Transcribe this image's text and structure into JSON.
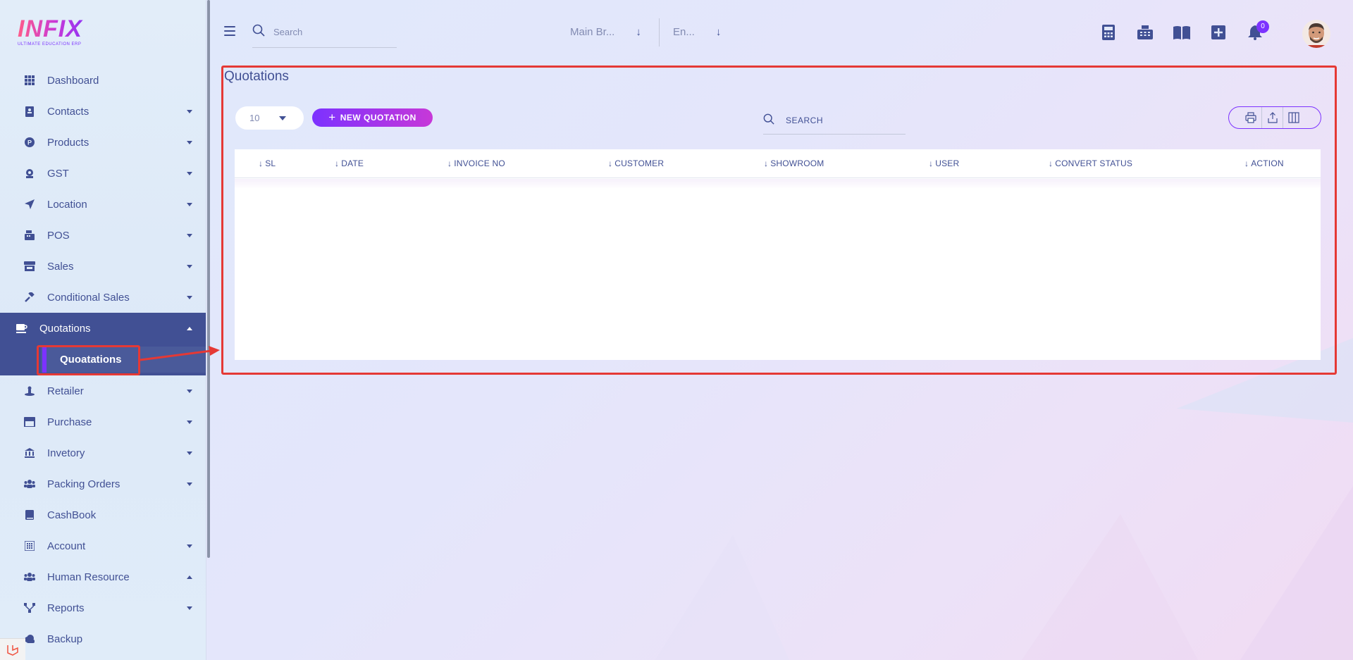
{
  "brand": {
    "logo_text": "INFIX",
    "logo_subtitle": "ULTIMATE EDUCATION ERP"
  },
  "sidebar": {
    "items": [
      {
        "label": "Dashboard",
        "icon": "grid-icon",
        "has_caret": false
      },
      {
        "label": "Contacts",
        "icon": "contacts-icon",
        "has_caret": true
      },
      {
        "label": "Products",
        "icon": "products-icon",
        "has_caret": true
      },
      {
        "label": "GST",
        "icon": "gst-icon",
        "has_caret": true
      },
      {
        "label": "Location",
        "icon": "location-arrow-icon",
        "has_caret": true
      },
      {
        "label": "POS",
        "icon": "cash-register-icon",
        "has_caret": true
      },
      {
        "label": "Sales",
        "icon": "store-icon",
        "has_caret": true
      },
      {
        "label": "Conditional Sales",
        "icon": "gavel-icon",
        "has_caret": true
      },
      {
        "label": "Quotations",
        "icon": "coffee-cup-icon",
        "has_caret": true,
        "expanded": true
      },
      {
        "label": "Retailer",
        "icon": "retailer-icon",
        "has_caret": true
      },
      {
        "label": "Purchase",
        "icon": "purchase-store-icon",
        "has_caret": true
      },
      {
        "label": "Invetory",
        "icon": "bank-icon",
        "has_caret": true
      },
      {
        "label": "Packing Orders",
        "icon": "users-icon",
        "has_caret": true
      },
      {
        "label": "CashBook",
        "icon": "book-icon",
        "has_caret": false
      },
      {
        "label": "Account",
        "icon": "calculator-icon",
        "has_caret": true
      },
      {
        "label": "Human Resource",
        "icon": "users-icon",
        "has_caret": true,
        "caret_up": true
      },
      {
        "label": "Reports",
        "icon": "sitemap-icon",
        "has_caret": true
      },
      {
        "label": "Backup",
        "icon": "cloud-icon",
        "has_caret": false
      }
    ],
    "active_sub_item": "Quoatations"
  },
  "topbar": {
    "search_placeholder": "Search",
    "branch_select": "Main Br...",
    "language_select": "En...",
    "notification_count": "0",
    "icons": [
      "calculator-icon",
      "cash-register-icon",
      "book-open-icon",
      "plus-square-icon",
      "bell-icon"
    ]
  },
  "main": {
    "title": "Quotations",
    "per_page": "10",
    "new_button_label": "NEW QUOTATION",
    "search_placeholder": "SEARCH",
    "export_icons": [
      "print-icon",
      "export-icon",
      "columns-icon"
    ],
    "table": {
      "columns": [
        "SL",
        "DATE",
        "INVOICE NO",
        "CUSTOMER",
        "SHOWROOM",
        "USER",
        "CONVERT STATUS",
        "ACTION"
      ],
      "rows": []
    }
  },
  "colors": {
    "primary": "#415094",
    "accent": "#7c32ff",
    "highlight": "#e53935"
  }
}
